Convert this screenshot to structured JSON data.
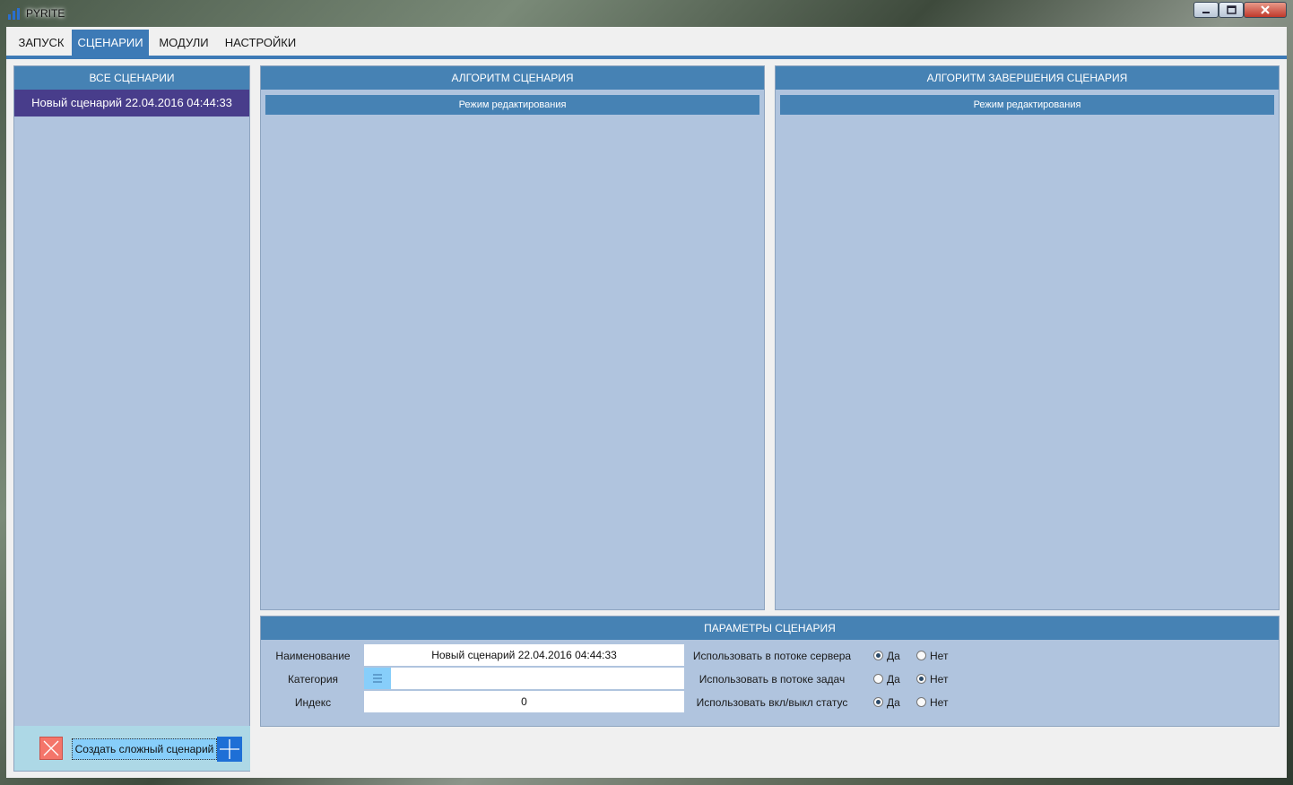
{
  "window": {
    "title": "PYRITE"
  },
  "tabs": [
    {
      "label": "ЗАПУСК",
      "active": false
    },
    {
      "label": "СЦЕНАРИИ",
      "active": true
    },
    {
      "label": "МОДУЛИ",
      "active": false
    },
    {
      "label": "НАСТРОЙКИ",
      "active": false
    }
  ],
  "scenarios_panel": {
    "header": "ВСЕ СЦЕНАРИИ",
    "items": [
      "Новый сценарий 22.04.2016 04:44:33"
    ],
    "selected_index": 0,
    "create_button_label": "Создать сложный сценарий",
    "delete_icon": "close-x-icon",
    "add_icon": "plus-icon"
  },
  "algorithm_panel": {
    "header": "АЛГОРИТМ СЦЕНАРИЯ",
    "mode_label": "Режим редактирования"
  },
  "finish_algorithm_panel": {
    "header": "АЛГОРИТМ ЗАВЕРШЕНИЯ СЦЕНАРИЯ",
    "mode_label": "Режим редактирования"
  },
  "params_panel": {
    "header": "ПАРАМЕТРЫ СЦЕНАРИЯ",
    "name_label": "Наименование",
    "name_value": "Новый сценарий 22.04.2016 04:44:33",
    "category_label": "Категория",
    "category_value": "",
    "category_icon": "list-icon",
    "index_label": "Индекс",
    "index_value": "0",
    "options": [
      {
        "label": "Использовать в потоке сервера",
        "yes": "Да",
        "no": "Нет",
        "selected": "yes"
      },
      {
        "label": "Использовать в потоке задач",
        "yes": "Да",
        "no": "Нет",
        "selected": "no"
      },
      {
        "label": "Использовать вкл/выкл статус",
        "yes": "Да",
        "no": "Нет",
        "selected": "yes"
      }
    ]
  },
  "colors": {
    "accent": "#4682b4",
    "panel_bg": "#b0c4de",
    "selected_item": "#483d8b",
    "footer_bg": "#add8e6",
    "delete_button": "#f4756a",
    "add_button": "#1e6fd6",
    "create_button": "#87cefa"
  }
}
